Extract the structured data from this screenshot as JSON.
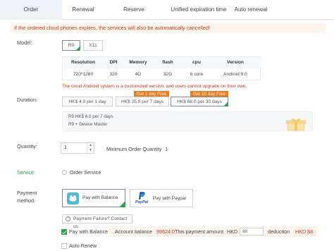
{
  "tabs": [
    {
      "label": "Order"
    },
    {
      "label": "Renewal"
    },
    {
      "label": "Reserve"
    },
    {
      "label": "Unified expiration time"
    },
    {
      "label": "Auto renewal"
    }
  ],
  "notice": "If the ordered cloud phones expires, the services will also be automatically cancelled!",
  "model": {
    "label": "Model:",
    "options": [
      "R9",
      "X11"
    ],
    "selected": "R9"
  },
  "specs": {
    "headers": [
      "Resolution",
      "DPI",
      "Memory",
      "flash",
      "cpu",
      "Version"
    ],
    "values": [
      "720*1280",
      "320",
      "4G",
      "32G",
      "6 core",
      "Android 9.0"
    ]
  },
  "warning": "The cloud Android system is a customized version, and users cannot upgrade on their own.",
  "duration": {
    "label": "Duration:",
    "options": [
      "HK$ 4.0 per 1 day",
      "HK$ 25.0 per 7 days",
      "HK$ 88.0 per 30 days"
    ],
    "badges": [
      "Get 1 day Free",
      "Get 10 day Free"
    ],
    "selected_index": 2
  },
  "plan": {
    "line1": "R9 HK$ 6.0 per 7 days",
    "line2": "R9 + Device Master"
  },
  "quantity": {
    "label": "Quantity:",
    "value": "1",
    "minimum_text": "Minimum Order Quantity",
    "minimum_value": "1"
  },
  "service": {
    "label": "Service:",
    "option": "Order Service"
  },
  "payment": {
    "label": "Payment method:",
    "balance_label": "Pay with Balance",
    "paypal_label": "Pay with Paypal",
    "paypal_logo": "PayPal",
    "failure_text": "Payment Failure? Contact us.",
    "pay_with_balance_check": "Pay with Balance",
    "account_balance_label": "Account balance",
    "account_balance_value": "99524.0",
    "payment_amount_label": "This payment amount",
    "currency": "HKD",
    "amount_value": "88",
    "deduction_label": "deduction",
    "deduction_value": "HKD 88"
  },
  "auto_renew": {
    "label": "Auto Renew"
  },
  "colors": {
    "accent_green": "#2da44e",
    "warning_red": "#d0301f",
    "badge_orange": "#ea7d1e",
    "notice_bg": "#fdf4ec"
  }
}
